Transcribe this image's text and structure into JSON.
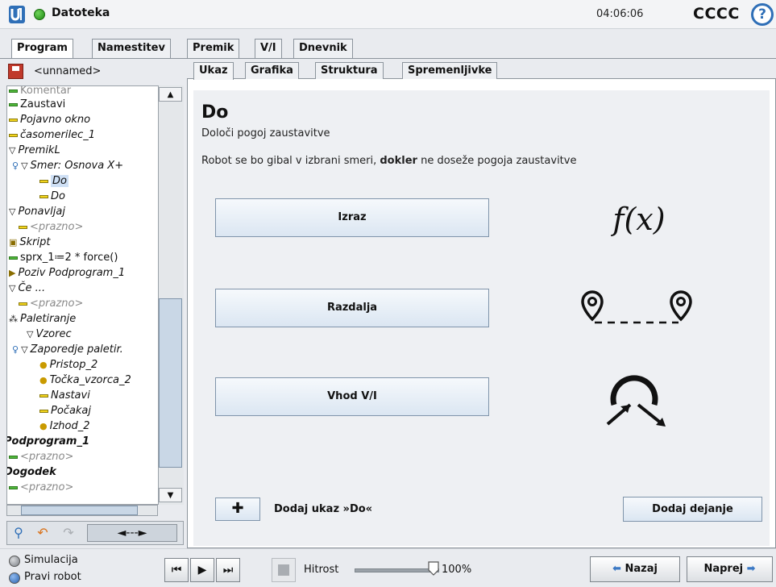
{
  "header": {
    "file_menu": "Datoteka",
    "clock": "04:06:06",
    "robot_name": "CCCC",
    "help_symbol": "?"
  },
  "top_tabs": [
    {
      "label": "Program",
      "active": true
    },
    {
      "label": "Namestitev",
      "active": false
    },
    {
      "label": "Premik",
      "active": false
    },
    {
      "label": "V/I",
      "active": false
    },
    {
      "label": "Dnevnik",
      "active": false
    }
  ],
  "tree": {
    "program_name": "<unnamed>",
    "nodes": [
      {
        "text": "Komentar",
        "icon": "line-green",
        "style": "gray",
        "indent": 0
      },
      {
        "text": "Zaustavi",
        "icon": "line-green",
        "style": "normal",
        "indent": 0
      },
      {
        "text": "Pojavno okno",
        "icon": "line-yellow",
        "style": "italic",
        "indent": 0
      },
      {
        "text": "časomerilec_1",
        "icon": "line-yellow",
        "style": "italic",
        "indent": 0
      },
      {
        "text": "PremikL",
        "icon": "triangle",
        "style": "italic",
        "indent": 0
      },
      {
        "text": "Smer: Osnova X+",
        "icon": "triangle",
        "style": "italic",
        "indent": 1
      },
      {
        "text": "Do",
        "icon": "line-yellow",
        "style": "italic-selected",
        "indent": 2
      },
      {
        "text": "Do",
        "icon": "line-yellow",
        "style": "italic",
        "indent": 2
      },
      {
        "text": "Ponavljaj",
        "icon": "triangle",
        "style": "italic",
        "indent": 0
      },
      {
        "text": "<prazno>",
        "icon": "line-yellow",
        "style": "gray-italic",
        "indent": 1
      },
      {
        "text": "Skript",
        "icon": "script",
        "style": "italic",
        "indent": 0
      },
      {
        "text": "sprx_1≔2 * force()",
        "icon": "line-green",
        "style": "normal",
        "indent": 0
      },
      {
        "text": "Poziv Podprogram_1",
        "icon": "call",
        "style": "italic",
        "indent": 0
      },
      {
        "text": "Če ...",
        "icon": "triangle",
        "style": "italic",
        "indent": 0
      },
      {
        "text": "<prazno>",
        "icon": "line-yellow",
        "style": "gray-italic",
        "indent": 1
      },
      {
        "text": "Paletiranje",
        "icon": "pallet",
        "style": "italic",
        "indent": 0
      },
      {
        "text": "Vzorec",
        "icon": "triangle",
        "style": "italic",
        "indent": 1
      },
      {
        "text": "Zaporedje paletir.",
        "icon": "triangle",
        "style": "italic",
        "indent": 1
      },
      {
        "text": "Pristop_2",
        "icon": "dot",
        "style": "italic",
        "indent": 2
      },
      {
        "text": "Točka_vzorca_2",
        "icon": "dot",
        "style": "italic",
        "indent": 2
      },
      {
        "text": "Nastavi",
        "icon": "line-yellow",
        "style": "italic",
        "indent": 2
      },
      {
        "text": "Počakaj",
        "icon": "line-yellow",
        "style": "italic",
        "indent": 2
      },
      {
        "text": "Izhod_2",
        "icon": "dot",
        "style": "italic",
        "indent": 2
      },
      {
        "text": "Podprogram_1",
        "icon": "none",
        "style": "bold-italic",
        "indent": 0
      },
      {
        "text": "<prazno>",
        "icon": "line-green",
        "style": "gray-italic",
        "indent": 0
      },
      {
        "text": "Dogodek",
        "icon": "none",
        "style": "bold-italic",
        "indent": 0
      },
      {
        "text": "<prazno>",
        "icon": "line-green",
        "style": "gray-italic",
        "indent": 0
      }
    ],
    "move_label": "◄---►"
  },
  "main_tabs": [
    {
      "label": "Ukaz",
      "active": true
    },
    {
      "label": "Grafika",
      "active": false
    },
    {
      "label": "Struktura",
      "active": false
    },
    {
      "label": "Spremenljivke",
      "active": false
    }
  ],
  "node": {
    "title": "Do",
    "subtitle": "Določi pogoj zaustavitve",
    "desc_before": "Robot se bo gibal v izbrani smeri, ",
    "desc_bold": "dokler",
    "desc_after": " ne doseže pogoja zaustavitve",
    "options": [
      {
        "label": "Izraz",
        "icon": "function-icon"
      },
      {
        "label": "Razdalja",
        "icon": "distance-icon"
      },
      {
        "label": "Vhod V/I",
        "icon": "io-icon"
      }
    ],
    "fx_text": "f(x)",
    "add_do_symbol": "✚",
    "add_do_label": "Dodaj ukaz »Do«",
    "add_action_label": "Dodaj dejanje"
  },
  "footer": {
    "simulation_label": "Simulacija",
    "real_robot_label": "Pravi robot",
    "speed_label": "Hitrost",
    "speed_value": "100%",
    "speed_fraction": 1.0,
    "back_label": "Nazaj",
    "next_label": "Naprej"
  }
}
